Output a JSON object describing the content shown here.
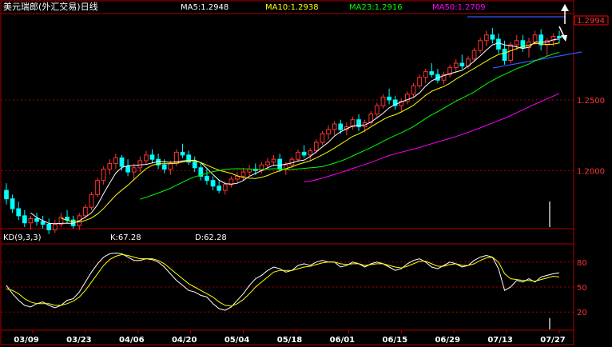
{
  "chart_data": [
    {
      "type": "candlestick",
      "title": "美元瑞郎(外汇交易)日线",
      "indicators": [
        {
          "label": "MA5:1.2948",
          "color": "#ffffff"
        },
        {
          "label": "MA10:1.2938",
          "color": "#ffff00"
        },
        {
          "label": "MA23:1.2916",
          "color": "#00ff00"
        },
        {
          "label": "MA50:1.2709",
          "color": "#ff00ff"
        }
      ],
      "last_price": "1.2994",
      "ylim": [
        1.16,
        1.31
      ],
      "y_ticks": [
        {
          "value": 1.25,
          "label": "1.2500"
        },
        {
          "value": 1.2,
          "label": "1.2000"
        }
      ],
      "x_tick_labels": [
        "03/09",
        "03/23",
        "04/06",
        "04/20",
        "05/04",
        "05/18",
        "06/01",
        "06/15",
        "06/29",
        "07/13",
        "07/27"
      ],
      "ohlc": [
        [
          1.186,
          1.191,
          1.176,
          1.18
        ],
        [
          1.18,
          1.183,
          1.17,
          1.173
        ],
        [
          1.173,
          1.178,
          1.165,
          1.168
        ],
        [
          1.168,
          1.172,
          1.16,
          1.163
        ],
        [
          1.163,
          1.168,
          1.158,
          1.166
        ],
        [
          1.166,
          1.17,
          1.161,
          1.164
        ],
        [
          1.164,
          1.168,
          1.159,
          1.162
        ],
        [
          1.162,
          1.166,
          1.155,
          1.158
        ],
        [
          1.158,
          1.165,
          1.156,
          1.162
        ],
        [
          1.162,
          1.17,
          1.16,
          1.167
        ],
        [
          1.167,
          1.172,
          1.163,
          1.165
        ],
        [
          1.165,
          1.168,
          1.159,
          1.161
        ],
        [
          1.161,
          1.17,
          1.158,
          1.168
        ],
        [
          1.168,
          1.176,
          1.166,
          1.174
        ],
        [
          1.174,
          1.185,
          1.172,
          1.183
        ],
        [
          1.183,
          1.195,
          1.181,
          1.193
        ],
        [
          1.193,
          1.203,
          1.19,
          1.201
        ],
        [
          1.201,
          1.208,
          1.197,
          1.205
        ],
        [
          1.205,
          1.212,
          1.201,
          1.209
        ],
        [
          1.209,
          1.211,
          1.2,
          1.203
        ],
        [
          1.203,
          1.208,
          1.196,
          1.199
        ],
        [
          1.199,
          1.205,
          1.193,
          1.202
        ],
        [
          1.202,
          1.21,
          1.199,
          1.207
        ],
        [
          1.207,
          1.214,
          1.204,
          1.211
        ],
        [
          1.211,
          1.215,
          1.205,
          1.208
        ],
        [
          1.208,
          1.212,
          1.201,
          1.204
        ],
        [
          1.204,
          1.208,
          1.198,
          1.201
        ],
        [
          1.201,
          1.207,
          1.197,
          1.205
        ],
        [
          1.205,
          1.215,
          1.203,
          1.213
        ],
        [
          1.213,
          1.219,
          1.209,
          1.211
        ],
        [
          1.211,
          1.214,
          1.204,
          1.206
        ],
        [
          1.206,
          1.21,
          1.199,
          1.202
        ],
        [
          1.202,
          1.206,
          1.193,
          1.196
        ],
        [
          1.196,
          1.201,
          1.19,
          1.193
        ],
        [
          1.193,
          1.196,
          1.186,
          1.189
        ],
        [
          1.189,
          1.193,
          1.184,
          1.186
        ],
        [
          1.186,
          1.192,
          1.183,
          1.19
        ],
        [
          1.19,
          1.196,
          1.188,
          1.194
        ],
        [
          1.194,
          1.199,
          1.191,
          1.196
        ],
        [
          1.196,
          1.202,
          1.193,
          1.199
        ],
        [
          1.199,
          1.204,
          1.196,
          1.201
        ],
        [
          1.201,
          1.205,
          1.197,
          1.2
        ],
        [
          1.2,
          1.206,
          1.198,
          1.204
        ],
        [
          1.204,
          1.209,
          1.201,
          1.206
        ],
        [
          1.206,
          1.211,
          1.203,
          1.208
        ],
        [
          1.208,
          1.212,
          1.199,
          1.201
        ],
        [
          1.201,
          1.206,
          1.197,
          1.204
        ],
        [
          1.204,
          1.21,
          1.202,
          1.208
        ],
        [
          1.208,
          1.215,
          1.206,
          1.213
        ],
        [
          1.213,
          1.218,
          1.209,
          1.211
        ],
        [
          1.211,
          1.216,
          1.207,
          1.214
        ],
        [
          1.214,
          1.222,
          1.212,
          1.22
        ],
        [
          1.22,
          1.228,
          1.218,
          1.226
        ],
        [
          1.226,
          1.232,
          1.222,
          1.229
        ],
        [
          1.229,
          1.235,
          1.225,
          1.233
        ],
        [
          1.233,
          1.236,
          1.226,
          1.229
        ],
        [
          1.229,
          1.234,
          1.225,
          1.231
        ],
        [
          1.231,
          1.238,
          1.229,
          1.236
        ],
        [
          1.236,
          1.24,
          1.228,
          1.231
        ],
        [
          1.231,
          1.236,
          1.227,
          1.234
        ],
        [
          1.234,
          1.242,
          1.232,
          1.24
        ],
        [
          1.24,
          1.248,
          1.238,
          1.246
        ],
        [
          1.246,
          1.254,
          1.244,
          1.252
        ],
        [
          1.252,
          1.258,
          1.247,
          1.25
        ],
        [
          1.25,
          1.253,
          1.243,
          1.246
        ],
        [
          1.246,
          1.251,
          1.242,
          1.249
        ],
        [
          1.249,
          1.256,
          1.247,
          1.254
        ],
        [
          1.254,
          1.262,
          1.252,
          1.26
        ],
        [
          1.26,
          1.268,
          1.258,
          1.266
        ],
        [
          1.266,
          1.272,
          1.262,
          1.27
        ],
        [
          1.27,
          1.276,
          1.266,
          1.268
        ],
        [
          1.268,
          1.272,
          1.262,
          1.264
        ],
        [
          1.264,
          1.27,
          1.261,
          1.268
        ],
        [
          1.268,
          1.275,
          1.266,
          1.273
        ],
        [
          1.273,
          1.279,
          1.269,
          1.276
        ],
        [
          1.276,
          1.282,
          1.272,
          1.274
        ],
        [
          1.274,
          1.281,
          1.272,
          1.279
        ],
        [
          1.279,
          1.287,
          1.277,
          1.285
        ],
        [
          1.285,
          1.294,
          1.283,
          1.292
        ],
        [
          1.292,
          1.299,
          1.288,
          1.296
        ],
        [
          1.296,
          1.301,
          1.29,
          1.293
        ],
        [
          1.293,
          1.297,
          1.283,
          1.286
        ],
        [
          1.286,
          1.292,
          1.275,
          1.278
        ],
        [
          1.278,
          1.291,
          1.276,
          1.289
        ],
        [
          1.289,
          1.296,
          1.285,
          1.292
        ],
        [
          1.292,
          1.296,
          1.284,
          1.287
        ],
        [
          1.287,
          1.294,
          1.28,
          1.291
        ],
        [
          1.291,
          1.299,
          1.289,
          1.296
        ],
        [
          1.296,
          1.3,
          1.285,
          1.289
        ],
        [
          1.289,
          1.294,
          1.281,
          1.292
        ],
        [
          1.292,
          1.297,
          1.288,
          1.295
        ],
        [
          1.295,
          1.299,
          1.29,
          1.294
        ]
      ]
    },
    {
      "type": "line",
      "title": "KD(9,3,3)",
      "values_text": {
        "k": "K:67.28",
        "d": "D:62.28"
      },
      "ylim": [
        0,
        100
      ],
      "y_ticks": [
        {
          "value": 80,
          "label": "80"
        },
        {
          "value": 50,
          "label": "50"
        },
        {
          "value": 20,
          "label": "20"
        }
      ],
      "series": [
        {
          "color": "#ffffff",
          "values": [
            52,
            42,
            34,
            28,
            26,
            30,
            32,
            28,
            25,
            28,
            34,
            36,
            44,
            56,
            68,
            78,
            86,
            90,
            91,
            90,
            86,
            82,
            82,
            84,
            83,
            80,
            74,
            66,
            58,
            52,
            46,
            44,
            40,
            38,
            30,
            24,
            22,
            26,
            34,
            42,
            52,
            60,
            64,
            70,
            74,
            72,
            68,
            70,
            76,
            78,
            76,
            80,
            82,
            80,
            80,
            74,
            76,
            80,
            78,
            74,
            78,
            80,
            78,
            74,
            70,
            72,
            78,
            82,
            84,
            80,
            74,
            72,
            76,
            80,
            78,
            74,
            76,
            82,
            86,
            88,
            86,
            72,
            46,
            50,
            58,
            56,
            60,
            56,
            62,
            64,
            66,
            67
          ]
        },
        {
          "color": "#ffff00",
          "values": [
            48,
            46,
            42,
            36,
            32,
            30,
            30,
            30,
            28,
            28,
            30,
            33,
            38,
            46,
            56,
            66,
            76,
            83,
            87,
            89,
            88,
            86,
            84,
            84,
            84,
            82,
            78,
            72,
            66,
            60,
            54,
            50,
            46,
            42,
            38,
            32,
            28,
            27,
            30,
            35,
            42,
            50,
            56,
            62,
            68,
            70,
            70,
            70,
            72,
            74,
            75,
            77,
            79,
            80,
            80,
            78,
            77,
            78,
            78,
            76,
            77,
            78,
            78,
            76,
            74,
            73,
            75,
            78,
            81,
            81,
            78,
            75,
            75,
            77,
            78,
            76,
            76,
            78,
            82,
            85,
            86,
            80,
            66,
            60,
            59,
            58,
            58,
            57,
            59,
            61,
            63,
            62
          ]
        }
      ]
    }
  ]
}
